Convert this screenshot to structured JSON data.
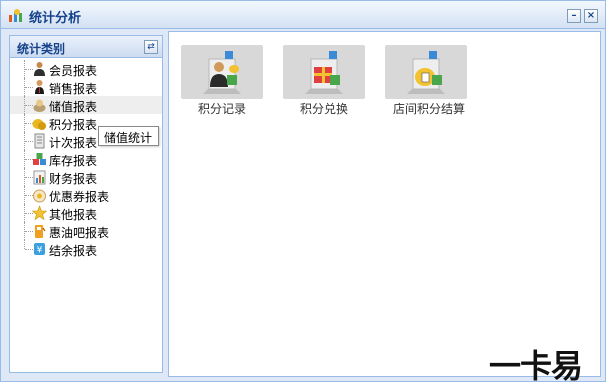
{
  "window": {
    "title": "统计分析",
    "minimize_glyph": "–",
    "close_glyph": "×",
    "app_icon": "chart-icon"
  },
  "sidebar": {
    "title": "统计类别",
    "refresh_icon": "refresh-icon",
    "items": [
      {
        "label": "会员报表",
        "icon": "member-icon"
      },
      {
        "label": "销售报表",
        "icon": "sales-icon"
      },
      {
        "label": "储值报表",
        "icon": "stored-value-icon"
      },
      {
        "label": "积分报表",
        "icon": "points-icon"
      },
      {
        "label": "计次报表",
        "icon": "count-icon"
      },
      {
        "label": "库存报表",
        "icon": "inventory-icon"
      },
      {
        "label": "财务报表",
        "icon": "finance-icon"
      },
      {
        "label": "优惠券报表",
        "icon": "coupon-icon"
      },
      {
        "label": "其他报表",
        "icon": "star-icon"
      },
      {
        "label": "惠油吧报表",
        "icon": "fuel-icon"
      },
      {
        "label": "结余报表",
        "icon": "balance-icon"
      }
    ],
    "selected_index": 2
  },
  "tooltip": {
    "text": "储值统计"
  },
  "main": {
    "tiles": [
      {
        "label": "积分记录",
        "icon": "points-record-icon"
      },
      {
        "label": "积分兑换",
        "icon": "points-exchange-icon"
      },
      {
        "label": "店间积分结算",
        "icon": "store-settlement-icon"
      }
    ]
  },
  "watermark": {
    "text": "一卡易"
  },
  "colors": {
    "title": "#15428b",
    "border": "#99bbe8",
    "selected": "#eeeeee"
  }
}
